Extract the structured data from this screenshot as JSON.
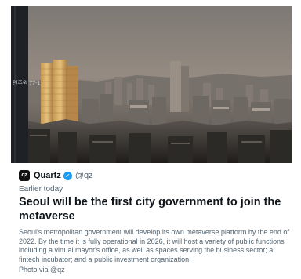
{
  "hero_image": {
    "tower_lettering": "인주원 77-1"
  },
  "source": {
    "logo_text": "qz",
    "name": "Quartz",
    "handle": "@qz",
    "verified_icon": "check-icon"
  },
  "meta": {
    "time": "Earlier today"
  },
  "article": {
    "headline": "Seoul will be the first city government to join the metaverse",
    "description": "Seoul's metropolitan government will develop its own metaverse platform by the end of 2022. By the time it is fully operational in 2026, it will host a variety of public functions including a virtual mayor's office, as well as spaces serving the business sector; a fintech incubator; and a public investment organization.",
    "credit": "Photo via @qz"
  },
  "colors": {
    "text_primary": "#0f1419",
    "text_secondary": "#536471",
    "verified_blue": "#1d9bf0"
  }
}
